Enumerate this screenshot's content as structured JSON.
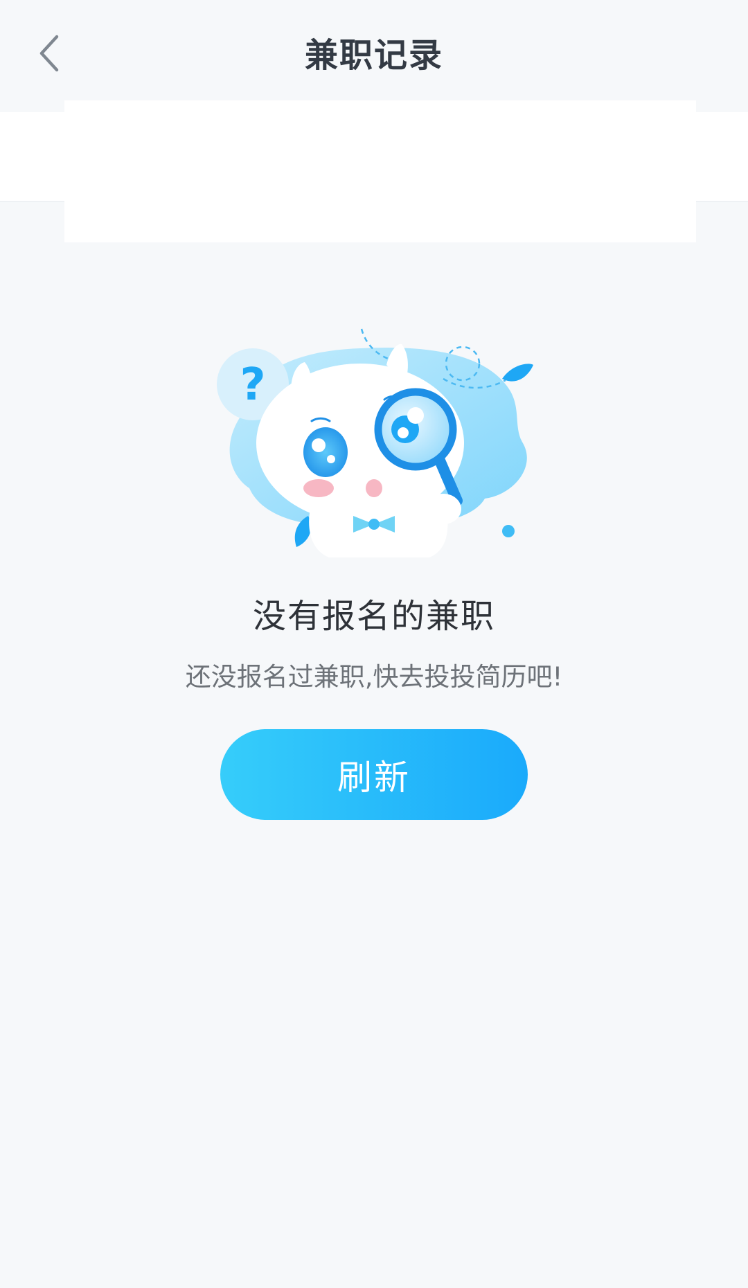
{
  "header": {
    "title": "兼职记录",
    "back_icon": "chevron-left-icon"
  },
  "empty_state": {
    "illustration": "mascot-magnifier-illustration",
    "question_mark": "?",
    "title": "没有报名的兼职",
    "subtitle": "还没报名过兼职,快去投投简历吧!",
    "refresh_label": "刷新"
  },
  "colors": {
    "background": "#f6f8fa",
    "title_text": "#333a44",
    "button_gradient_start": "#36cdfa",
    "button_gradient_end": "#1aaafb",
    "illustration_blue": "#1ea7f5"
  }
}
